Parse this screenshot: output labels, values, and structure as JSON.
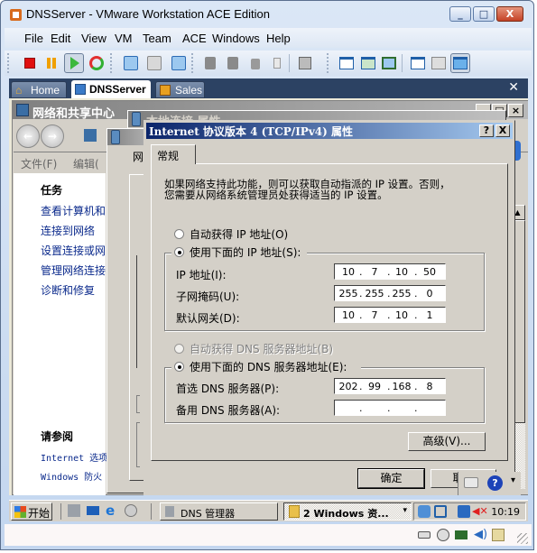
{
  "window": {
    "title": "DNSServer - VMware Workstation ACE Edition",
    "controls": {
      "minimize": "_",
      "maximize": "□",
      "close": "X"
    }
  },
  "menubar": [
    "File",
    "Edit",
    "View",
    "VM",
    "Team",
    "ACE",
    "Windows",
    "Help"
  ],
  "toolbar": {
    "icons": [
      "power-off-icon",
      "suspend-icon",
      "power-on-icon",
      "reset-icon",
      "snapshot-icon",
      "revert-snapshot-icon",
      "snapshot-manager-icon",
      "clone-icon",
      "clone-linked-icon",
      "new-vm-icon",
      "usb-icon",
      "console-icon",
      "sidebar-icon",
      "full-screen-icon",
      "quick-switch-icon",
      "settings-icon",
      "summary-icon",
      "console-view-icon"
    ]
  },
  "tabs": [
    {
      "label": "Home",
      "icon": "home-icon",
      "active": false
    },
    {
      "label": "DNSServer",
      "icon": "vm-icon",
      "active": true
    },
    {
      "label": "Sales",
      "icon": "team-icon",
      "active": false
    }
  ],
  "tab_close": "✕",
  "guest": {
    "network_center": {
      "title": "网络和共享中心",
      "menu": [
        "文件(F)",
        "编辑("
      ],
      "tasks_heading": "任务",
      "tasks": [
        "查看计算机和",
        "连接到网络",
        "设置连接或网",
        "管理网络连接",
        "诊断和修复"
      ],
      "see_also_heading": "请参阅",
      "see_also": [
        "Internet 选项",
        "Windows 防火"
      ]
    },
    "local_connection": {
      "title": "本地连接 属性",
      "tab_fragment": "网"
    },
    "dialog": {
      "title": "Internet 协议版本 4 (TCP/IPv4) 属性",
      "help_btn": "?",
      "close_btn": "X",
      "tab": "常规",
      "description": [
        "如果网络支持此功能，则可以获取自动指派的 IP 设置。否则，",
        "您需要从网络系统管理员处获得适当的 IP 设置。"
      ],
      "ip": {
        "auto_label": "自动获得 IP 地址(O)",
        "manual_label": "使用下面的 IP 地址(S):",
        "mode": "manual",
        "fields": [
          {
            "label": "IP 地址(I):",
            "octets": [
              "10",
              "7",
              "10",
              "50"
            ]
          },
          {
            "label": "子网掩码(U):",
            "octets": [
              "255",
              "255",
              "255",
              "0"
            ]
          },
          {
            "label": "默认网关(D):",
            "octets": [
              "10",
              "7",
              "10",
              "1"
            ]
          }
        ]
      },
      "dns": {
        "auto_label": "自动获得 DNS 服务器地址(B)",
        "manual_label": "使用下面的 DNS 服务器地址(E):",
        "mode": "manual",
        "fields": [
          {
            "label": "首选 DNS 服务器(P):",
            "octets": [
              "202",
              "99",
              "168",
              "8"
            ]
          },
          {
            "label": "备用 DNS 服务器(A):",
            "octets": [
              "",
              "",
              "",
              ""
            ]
          }
        ]
      },
      "advanced_btn": "高级(V)...",
      "ok_btn": "确定",
      "cancel_btn": "取消"
    },
    "taskbar": {
      "start": "开始",
      "tasks": [
        {
          "label": "DNS 管理器",
          "pressed": false
        },
        {
          "label": "2 Windows 资...",
          "pressed": true
        }
      ],
      "clock": "10:19"
    }
  },
  "statusbar": {
    "icons": [
      "hard-disk-icon",
      "cd-rom-disconnected-icon",
      "network-adapter-icon",
      "sound-icon",
      "message-log-icon"
    ]
  },
  "colors": {
    "dialog_title_start": "#0a246a",
    "dialog_title_end": "#a6caf0",
    "link": "#0b2a8c",
    "tab_bar": "#2c4263"
  }
}
